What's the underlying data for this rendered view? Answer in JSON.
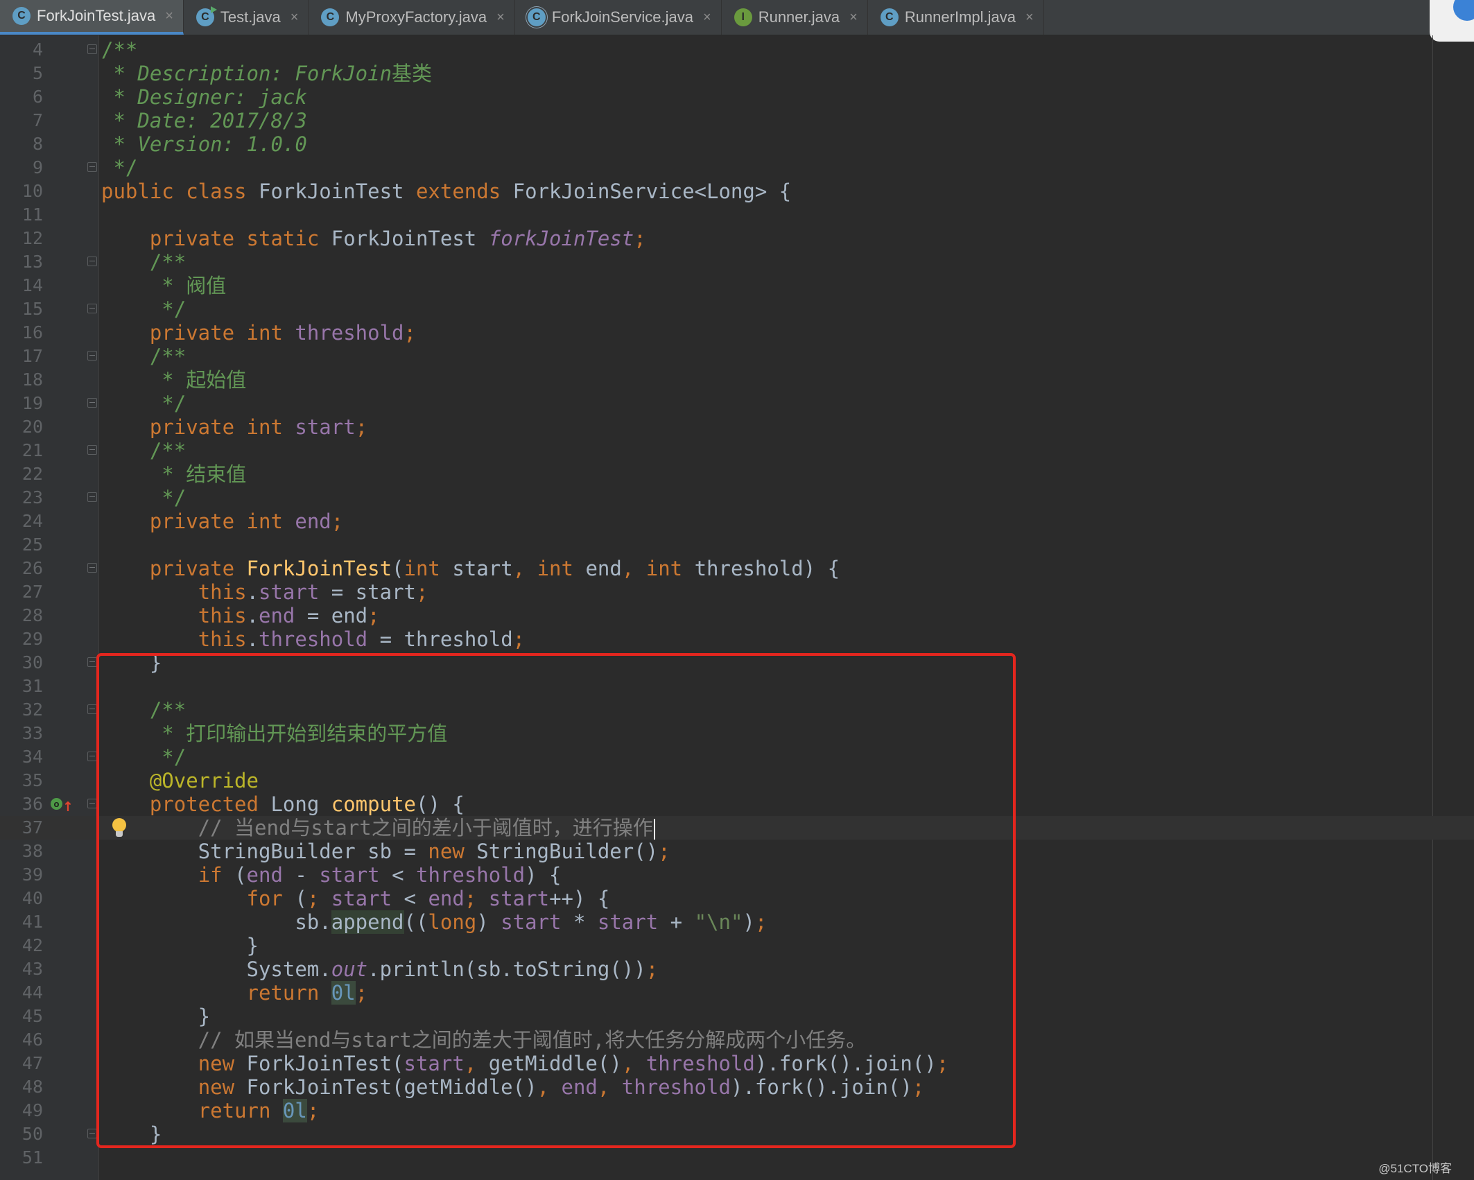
{
  "tabs": [
    {
      "label": "ForkJoinTest.java",
      "icon": "class-icon",
      "active": true
    },
    {
      "label": "Test.java",
      "icon": "runnable-class-icon",
      "active": false
    },
    {
      "label": "MyProxyFactory.java",
      "icon": "class-icon",
      "active": false
    },
    {
      "label": "ForkJoinService.java",
      "icon": "abstract-class-icon",
      "active": false
    },
    {
      "label": "Runner.java",
      "icon": "interface-icon",
      "active": false
    },
    {
      "label": "RunnerImpl.java",
      "icon": "class-icon",
      "active": false
    }
  ],
  "tab_close_glyph": "×",
  "colors": {
    "background": "#2b2b2b",
    "keyword": "#cc7832",
    "field": "#9876aa",
    "method_decl": "#ffc66d",
    "doc_comment": "#629755",
    "line_comment": "#808080",
    "number": "#6897bb",
    "string": "#6a8759",
    "annotation": "#bbb529",
    "highlight_box": "#e3261e"
  },
  "editor": {
    "caret_line": 37,
    "lines": [
      {
        "n": "4",
        "fold": true,
        "t": [
          [
            "dcz",
            "/**"
          ]
        ]
      },
      {
        "n": "5",
        "t": [
          [
            "dcz",
            " * "
          ],
          [
            "dc",
            "Description: ForkJoin"
          ],
          [
            "dcz",
            "基类"
          ]
        ]
      },
      {
        "n": "6",
        "t": [
          [
            "dcz",
            " * "
          ],
          [
            "dc",
            "Designer: jack"
          ]
        ]
      },
      {
        "n": "7",
        "t": [
          [
            "dcz",
            " * "
          ],
          [
            "dc",
            "Date: 2017/8/3"
          ]
        ]
      },
      {
        "n": "8",
        "t": [
          [
            "dcz",
            " * "
          ],
          [
            "dc",
            "Version: 1.0.0"
          ]
        ]
      },
      {
        "n": "9",
        "fold": true,
        "t": [
          [
            "dcz",
            " */"
          ]
        ]
      },
      {
        "n": "10",
        "t": [
          [
            "k",
            "public class "
          ],
          [
            "p",
            "ForkJoinTest "
          ],
          [
            "k",
            "extends "
          ],
          [
            "p",
            "ForkJoinService<Long> {"
          ]
        ]
      },
      {
        "n": "11",
        "t": []
      },
      {
        "n": "12",
        "t": [
          [
            "p",
            "    "
          ],
          [
            "k",
            "private static "
          ],
          [
            "p",
            "ForkJoinTest "
          ],
          [
            "sf",
            "forkJoinTest"
          ],
          [
            "k",
            ";"
          ]
        ]
      },
      {
        "n": "13",
        "fold": true,
        "t": [
          [
            "dcz",
            "    /**"
          ]
        ]
      },
      {
        "n": "14",
        "t": [
          [
            "dcz",
            "     * 阀值"
          ]
        ]
      },
      {
        "n": "15",
        "fold": true,
        "t": [
          [
            "dcz",
            "     */"
          ]
        ]
      },
      {
        "n": "16",
        "t": [
          [
            "p",
            "    "
          ],
          [
            "k",
            "private int "
          ],
          [
            "f",
            "threshold"
          ],
          [
            "k",
            ";"
          ]
        ]
      },
      {
        "n": "17",
        "fold": true,
        "t": [
          [
            "dcz",
            "    /**"
          ]
        ]
      },
      {
        "n": "18",
        "t": [
          [
            "dcz",
            "     * 起始值"
          ]
        ]
      },
      {
        "n": "19",
        "fold": true,
        "t": [
          [
            "dcz",
            "     */"
          ]
        ]
      },
      {
        "n": "20",
        "t": [
          [
            "p",
            "    "
          ],
          [
            "k",
            "private int "
          ],
          [
            "f",
            "start"
          ],
          [
            "k",
            ";"
          ]
        ]
      },
      {
        "n": "21",
        "fold": true,
        "t": [
          [
            "dcz",
            "    /**"
          ]
        ]
      },
      {
        "n": "22",
        "t": [
          [
            "dcz",
            "     * 结束值"
          ]
        ]
      },
      {
        "n": "23",
        "fold": true,
        "t": [
          [
            "dcz",
            "     */"
          ]
        ]
      },
      {
        "n": "24",
        "t": [
          [
            "p",
            "    "
          ],
          [
            "k",
            "private int "
          ],
          [
            "f",
            "end"
          ],
          [
            "k",
            ";"
          ]
        ]
      },
      {
        "n": "25",
        "t": []
      },
      {
        "n": "26",
        "fold": true,
        "t": [
          [
            "p",
            "    "
          ],
          [
            "k",
            "private "
          ],
          [
            "fn",
            "ForkJoinTest"
          ],
          [
            "p",
            "("
          ],
          [
            "k",
            "int "
          ],
          [
            "p",
            "start"
          ],
          [
            "k",
            ", int "
          ],
          [
            "p",
            "end"
          ],
          [
            "k",
            ", int "
          ],
          [
            "p",
            "threshold) {"
          ]
        ]
      },
      {
        "n": "27",
        "t": [
          [
            "p",
            "        "
          ],
          [
            "k",
            "this"
          ],
          [
            "p",
            "."
          ],
          [
            "f",
            "start "
          ],
          [
            "p",
            "= start"
          ],
          [
            "k",
            ";"
          ]
        ]
      },
      {
        "n": "28",
        "t": [
          [
            "p",
            "        "
          ],
          [
            "k",
            "this"
          ],
          [
            "p",
            "."
          ],
          [
            "f",
            "end "
          ],
          [
            "p",
            "= end"
          ],
          [
            "k",
            ";"
          ]
        ]
      },
      {
        "n": "29",
        "t": [
          [
            "p",
            "        "
          ],
          [
            "k",
            "this"
          ],
          [
            "p",
            "."
          ],
          [
            "f",
            "threshold "
          ],
          [
            "p",
            "= threshold"
          ],
          [
            "k",
            ";"
          ]
        ]
      },
      {
        "n": "30",
        "fold": true,
        "t": [
          [
            "p",
            "    }"
          ]
        ]
      },
      {
        "n": "31",
        "t": []
      },
      {
        "n": "32",
        "fold": true,
        "t": [
          [
            "dcz",
            "    /**"
          ]
        ]
      },
      {
        "n": "33",
        "t": [
          [
            "dcz",
            "     * 打印输出开始到结束的平方值"
          ]
        ]
      },
      {
        "n": "34",
        "fold": true,
        "t": [
          [
            "dcz",
            "     */"
          ]
        ]
      },
      {
        "n": "35",
        "t": [
          [
            "an",
            "    @Override"
          ]
        ]
      },
      {
        "n": "36",
        "fold": true,
        "override": true,
        "t": [
          [
            "p",
            "    "
          ],
          [
            "k",
            "protected "
          ],
          [
            "p",
            "Long "
          ],
          [
            "fn",
            "compute"
          ],
          [
            "p",
            "() {"
          ]
        ]
      },
      {
        "n": "37",
        "bulb": true,
        "caret": true,
        "t": [
          [
            "lc",
            "        // 当end与start之间的差小于阈值时，进行操作"
          ]
        ]
      },
      {
        "n": "38",
        "t": [
          [
            "p",
            "        StringBuilder sb = "
          ],
          [
            "k",
            "new "
          ],
          [
            "p",
            "StringBuilder()"
          ],
          [
            "k",
            ";"
          ]
        ]
      },
      {
        "n": "39",
        "t": [
          [
            "p",
            "        "
          ],
          [
            "k",
            "if "
          ],
          [
            "p",
            "("
          ],
          [
            "f",
            "end "
          ],
          [
            "p",
            "- "
          ],
          [
            "f",
            "start "
          ],
          [
            "p",
            "< "
          ],
          [
            "f",
            "threshold"
          ],
          [
            "p",
            ") {"
          ]
        ]
      },
      {
        "n": "40",
        "t": [
          [
            "p",
            "            "
          ],
          [
            "k",
            "for "
          ],
          [
            "p",
            "("
          ],
          [
            "k",
            "; "
          ],
          [
            "f",
            "start "
          ],
          [
            "p",
            "< "
          ],
          [
            "f",
            "end"
          ],
          [
            "k",
            "; "
          ],
          [
            "f",
            "start"
          ],
          [
            "p",
            "++) {"
          ]
        ]
      },
      {
        "n": "41",
        "t": [
          [
            "p",
            "                sb."
          ],
          [
            "mh",
            "append"
          ],
          [
            "p",
            "(("
          ],
          [
            "k",
            "long"
          ],
          [
            "p",
            ") "
          ],
          [
            "f",
            "start "
          ],
          [
            "p",
            "* "
          ],
          [
            "f",
            "start "
          ],
          [
            "p",
            "+ "
          ],
          [
            "s",
            "\"\\n\""
          ],
          [
            "p",
            ")"
          ],
          [
            "k",
            ";"
          ]
        ]
      },
      {
        "n": "42",
        "t": [
          [
            "p",
            "            }"
          ]
        ]
      },
      {
        "n": "43",
        "t": [
          [
            "p",
            "            System."
          ],
          [
            "sf",
            "out"
          ],
          [
            "p",
            ".println(sb.toString())"
          ],
          [
            "k",
            ";"
          ]
        ]
      },
      {
        "n": "44",
        "t": [
          [
            "p",
            "            "
          ],
          [
            "k",
            "return "
          ],
          [
            "nh",
            "0l"
          ],
          [
            "k",
            ";"
          ]
        ]
      },
      {
        "n": "45",
        "t": [
          [
            "p",
            "        }"
          ]
        ]
      },
      {
        "n": "46",
        "t": [
          [
            "lc",
            "        // 如果当end与start之间的差大于阈值时,将大任务分解成两个小任务。"
          ]
        ]
      },
      {
        "n": "47",
        "t": [
          [
            "p",
            "        "
          ],
          [
            "k",
            "new "
          ],
          [
            "p",
            "ForkJoinTest("
          ],
          [
            "f",
            "start"
          ],
          [
            "k",
            ", "
          ],
          [
            "p",
            "getMiddle()"
          ],
          [
            "k",
            ", "
          ],
          [
            "f",
            "threshold"
          ],
          [
            "p",
            ").fork().join()"
          ],
          [
            "k",
            ";"
          ]
        ]
      },
      {
        "n": "48",
        "t": [
          [
            "p",
            "        "
          ],
          [
            "k",
            "new "
          ],
          [
            "p",
            "ForkJoinTest(getMiddle()"
          ],
          [
            "k",
            ", "
          ],
          [
            "f",
            "end"
          ],
          [
            "k",
            ", "
          ],
          [
            "f",
            "threshold"
          ],
          [
            "p",
            ").fork().join()"
          ],
          [
            "k",
            ";"
          ]
        ]
      },
      {
        "n": "49",
        "t": [
          [
            "p",
            "        "
          ],
          [
            "k",
            "return "
          ],
          [
            "nh",
            "0l"
          ],
          [
            "k",
            ";"
          ]
        ]
      },
      {
        "n": "50",
        "fold": true,
        "t": [
          [
            "p",
            "    }"
          ]
        ]
      },
      {
        "n": "51",
        "t": []
      }
    ]
  },
  "watermark": "@51CTO博客"
}
